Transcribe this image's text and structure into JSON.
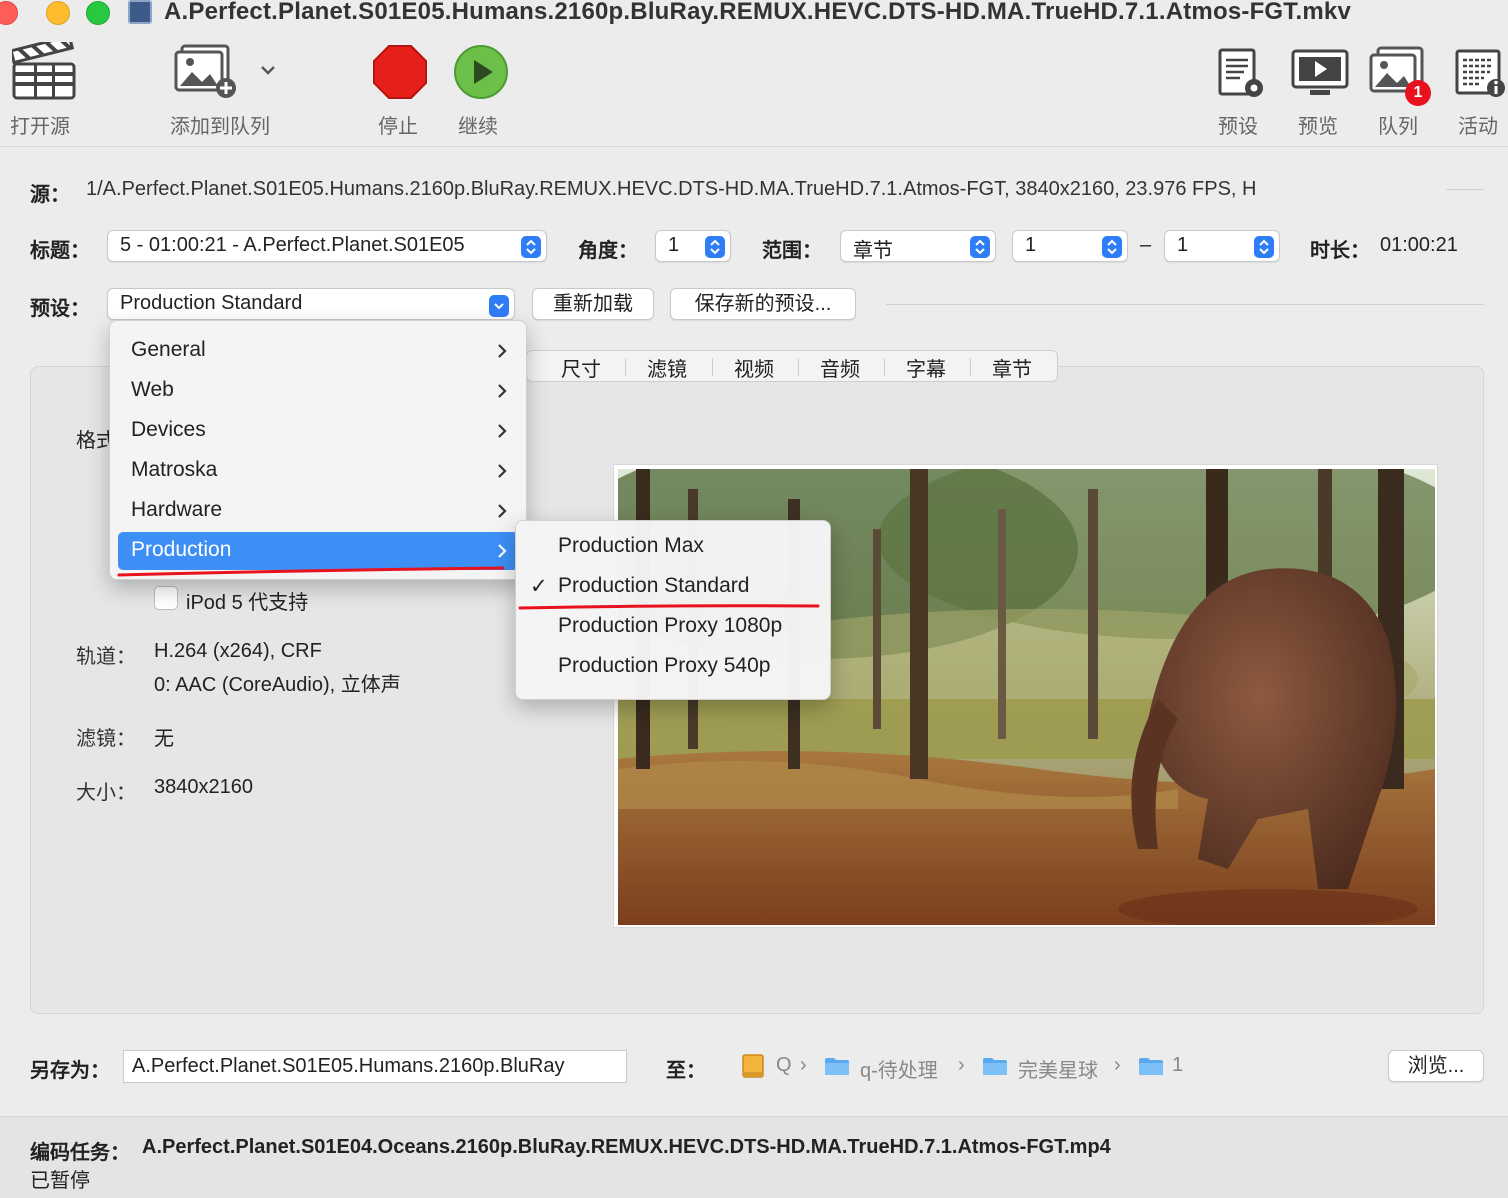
{
  "window": {
    "title": "A.Perfect.Planet.S01E05.Humans.2160p.BluRay.REMUX.HEVC.DTS-HD.MA.TrueHD.7.1.Atmos-FGT.mkv"
  },
  "toolbar": {
    "open_source": "打开源",
    "add_to_queue": "添加到队列",
    "stop": "停止",
    "resume": "继续",
    "presets": "预设",
    "preview": "预览",
    "queue": "队列",
    "queue_badge": "1",
    "activity": "活动"
  },
  "source": {
    "label": "源：",
    "value": "1/A.Perfect.Planet.S01E05.Humans.2160p.BluRay.REMUX.HEVC.DTS-HD.MA.TrueHD.7.1.Atmos-FGT, 3840x2160, 23.976 FPS, H"
  },
  "title_row": {
    "title_label": "标题：",
    "title_value": "5 - 01:00:21 - A.Perfect.Planet.S01E05",
    "angle_label": "角度：",
    "angle_value": "1",
    "range_label": "范围：",
    "range_type": "章节",
    "range_start": "1",
    "range_dash": "–",
    "range_end": "1",
    "duration_label": "时长：",
    "duration_value": "01:00:21"
  },
  "preset_row": {
    "label": "预设：",
    "value": "Production Standard",
    "reload": "重新加载",
    "save_new": "保存新的预设..."
  },
  "tabs": [
    "尺寸",
    "滤镜",
    "视频",
    "音频",
    "字幕",
    "章节"
  ],
  "summary": {
    "format_label": "格式",
    "ipod_label": "iPod 5 代支持",
    "tracks_label": "轨道：",
    "tracks_line1": "H.264 (x264), CRF",
    "tracks_line2": "0: AAC (CoreAudio), 立体声",
    "filters_label": "滤镜：",
    "filters_value": "无",
    "size_label": "大小：",
    "size_value": "3840x2160"
  },
  "preset_menu": {
    "items": [
      {
        "label": "General"
      },
      {
        "label": "Web"
      },
      {
        "label": "Devices"
      },
      {
        "label": "Matroska"
      },
      {
        "label": "Hardware"
      },
      {
        "label": "Production"
      }
    ],
    "selected": "Production"
  },
  "production_submenu": {
    "items": [
      {
        "label": "Production Max"
      },
      {
        "label": "Production Standard"
      },
      {
        "label": "Production Proxy 1080p"
      },
      {
        "label": "Production Proxy 540p"
      }
    ],
    "checked": "Production Standard",
    "check_mark": "✓"
  },
  "save": {
    "label": "另存为：",
    "filename": "A.Perfect.Planet.S01E05.Humans.2160p.BluRay",
    "to_label": "至：",
    "path": [
      "Q",
      "q-待处理",
      "完美星球",
      "1"
    ],
    "browse": "浏览..."
  },
  "footer": {
    "label": "编码任务：",
    "job": "A.Perfect.Planet.S01E04.Oceans.2160p.BluRay.REMUX.HEVC.DTS-HD.MA.TrueHD.7.1.Atmos-FGT.mp4",
    "status": "已暂停"
  },
  "colors": {
    "accent": "#2f7df6",
    "menu_selected": "#3d8ff6",
    "annotation_red": "#e8121e",
    "stop_red": "#e8201c",
    "go_green": "#6cc04a"
  }
}
